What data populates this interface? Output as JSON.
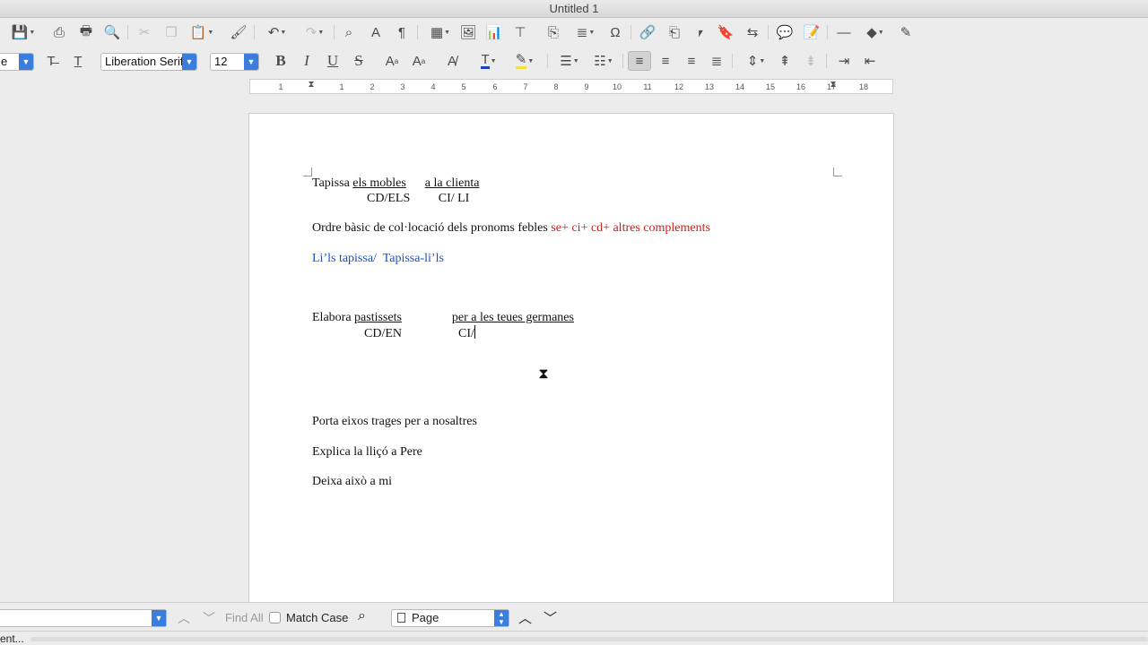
{
  "window": {
    "title": "Untitled 1"
  },
  "toolbar_format": {
    "style_name": "e",
    "font_name": "Liberation Serif",
    "font_size": "12",
    "font_color": "#1f3fbf",
    "highlight_color": "#f0e040"
  },
  "ruler": {
    "ticks": [
      "1",
      "1",
      "2",
      "3",
      "4",
      "5",
      "6",
      "7",
      "8",
      "9",
      "10",
      "11",
      "12",
      "13",
      "14",
      "15",
      "16",
      "17",
      "18"
    ]
  },
  "document": {
    "line1": {
      "a": "Tapissa ",
      "b": "els mobles",
      "c": "      ",
      "d": "a la clienta"
    },
    "line2": "CD/ELS         CI/ LI",
    "line3": {
      "a": "Ordre bàsic de col·locació dels pronoms febles ",
      "b": "se+ ci+ cd+ altres complements"
    },
    "line4": "Li’ls tapissa/  Tapissa-li’ls",
    "line5": {
      "a": "Elabora ",
      "b": "pastissets",
      "c": "                ",
      "d": "per a les teues germanes"
    },
    "line6": "CD/EN                  CI/",
    "line7": "Porta eixos trages per a nosaltres",
    "line8": "Explica la lliçó a Pere",
    "line9": "Deixa això a mi"
  },
  "findbar": {
    "find_all": "Find All",
    "match_case": "Match Case",
    "search_scope": "Page"
  },
  "status": {
    "text": "ent..."
  }
}
